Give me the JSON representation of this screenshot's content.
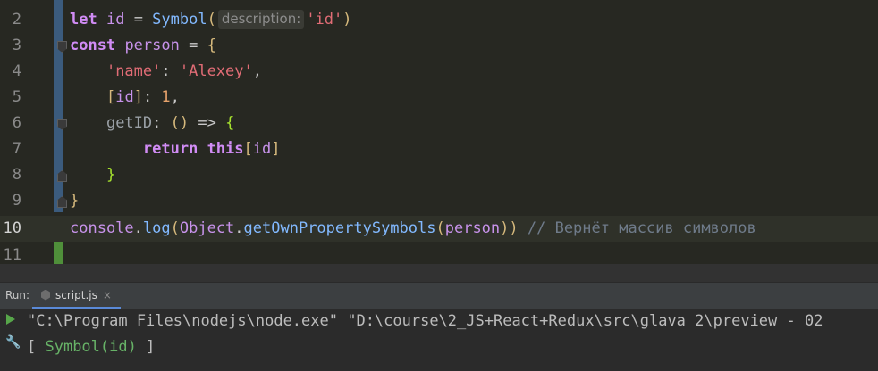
{
  "editor": {
    "lines": [
      {
        "num": "2"
      },
      {
        "num": "3"
      },
      {
        "num": "4"
      },
      {
        "num": "5"
      },
      {
        "num": "6"
      },
      {
        "num": "7"
      },
      {
        "num": "8"
      },
      {
        "num": "9"
      },
      {
        "num": "10"
      },
      {
        "num": "11"
      }
    ],
    "tokens": {
      "l2_let": "let",
      "l2_id": "id",
      "l2_eq": " = ",
      "l2_symbol": "Symbol",
      "l2_open": "(",
      "l2_hint": "description:",
      "l2_str": "'id'",
      "l2_close": ")",
      "l3_const": "const",
      "l3_person": "person",
      "l3_eq": " = ",
      "l3_brace": "{",
      "l4_key": "'name'",
      "l4_colon": ": ",
      "l4_val": "'Alexey'",
      "l4_comma": ",",
      "l5_open": "[",
      "l5_id": "id",
      "l5_close": "]",
      "l5_colon": ": ",
      "l5_num": "1",
      "l5_comma": ",",
      "l6_key": "getID",
      "l6_colon": ": ",
      "l6_parens": "()",
      "l6_arrow": " => ",
      "l6_brace": "{",
      "l7_return": "return",
      "l7_this": "this",
      "l7_open": "[",
      "l7_id": "id",
      "l7_close": "]",
      "l8_brace": "}",
      "l9_brace": "}",
      "l10_console": "console",
      "l10_dot1": ".",
      "l10_log": "log",
      "l10_open1": "(",
      "l10_object": "Object",
      "l10_dot2": ".",
      "l10_method": "getOwnPropertySymbols",
      "l10_open2": "(",
      "l10_person": "person",
      "l10_close": "))",
      "l10_comment": " // Вернёт массив символов"
    }
  },
  "run_panel": {
    "label": "Run:",
    "tab_label": "script.js",
    "tab_close": "×",
    "output": [
      "\"C:\\Program Files\\nodejs\\node.exe\" \"D:\\course\\2_JS+React+Redux\\src\\glava 2\\preview - 02",
      "Symbol(id)"
    ],
    "output_prefix": "[ ",
    "output_suffix": " ]"
  },
  "icons": {
    "play": "play-icon",
    "wrench": "wrench-icon",
    "script": "js-file-icon"
  },
  "colors": {
    "editor_bg": "#272822",
    "keyword": "#d18cf5",
    "string": "#f0c35c",
    "number": "#e6a26b",
    "function": "#82b9ff",
    "comment": "#6f7b8a",
    "vcs_modified": "#3b5b7d",
    "vcs_added": "#4f8f3a",
    "run_play": "#57a64a"
  }
}
